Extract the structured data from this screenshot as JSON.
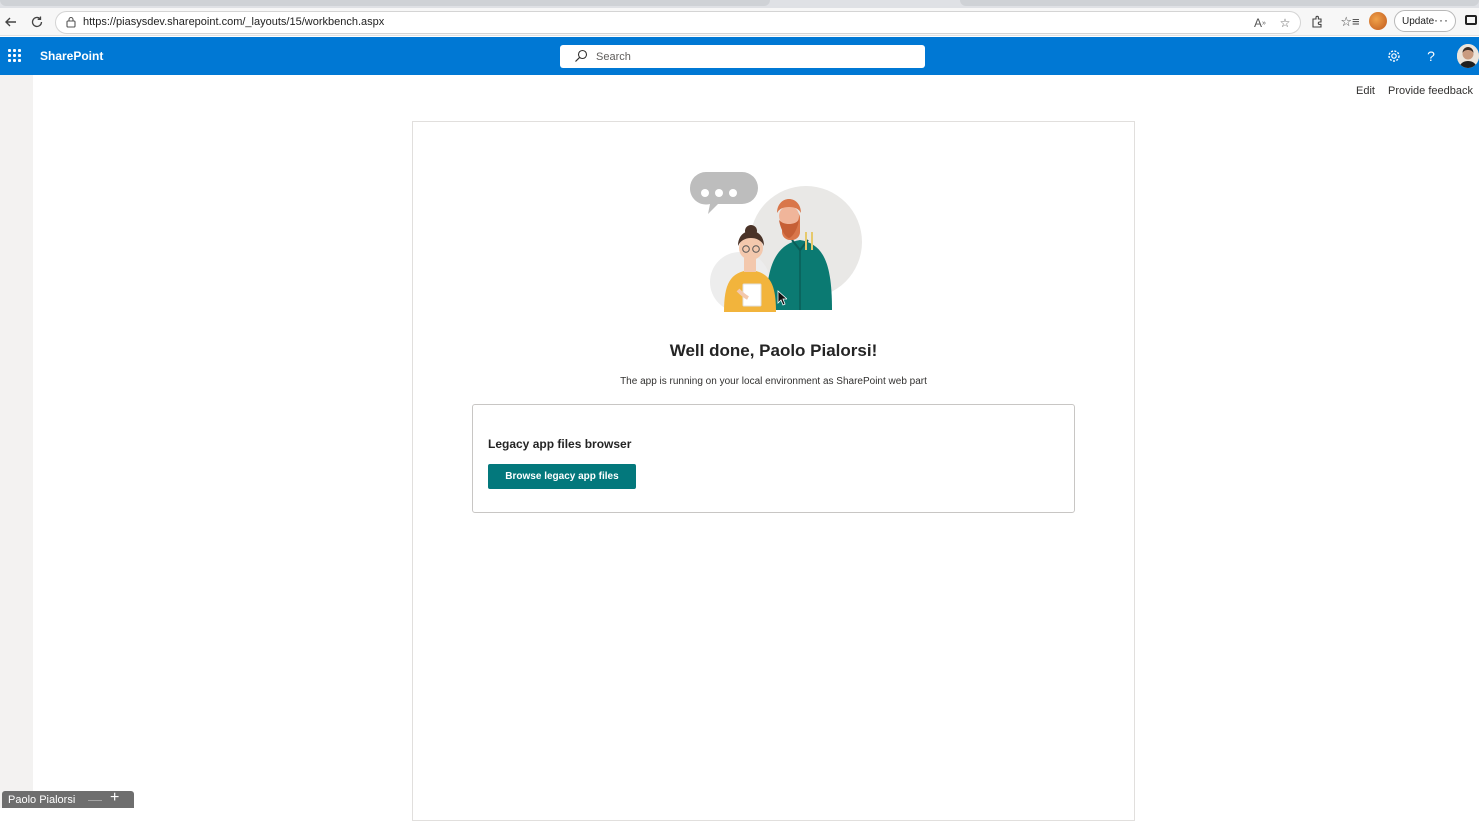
{
  "browser": {
    "url": "https://piasysdev.sharepoint.com/_layouts/15/workbench.aspx",
    "update_label": "Update",
    "more_label": "···"
  },
  "suitebar": {
    "brand": "SharePoint",
    "search_placeholder": "Search",
    "accent_color": "#0078d4"
  },
  "commands": {
    "edit": "Edit",
    "feedback": "Provide feedback"
  },
  "webpart": {
    "headline": "Well done, Paolo Pialorsi!",
    "subline": "The app is running on your local environment as SharePoint web part",
    "card_title": "Legacy app files browser",
    "card_button": "Browse legacy app files",
    "button_color": "#03787c"
  },
  "footer_pill": {
    "user": "Paolo Pialorsi",
    "minus": "—",
    "plus": "+"
  }
}
